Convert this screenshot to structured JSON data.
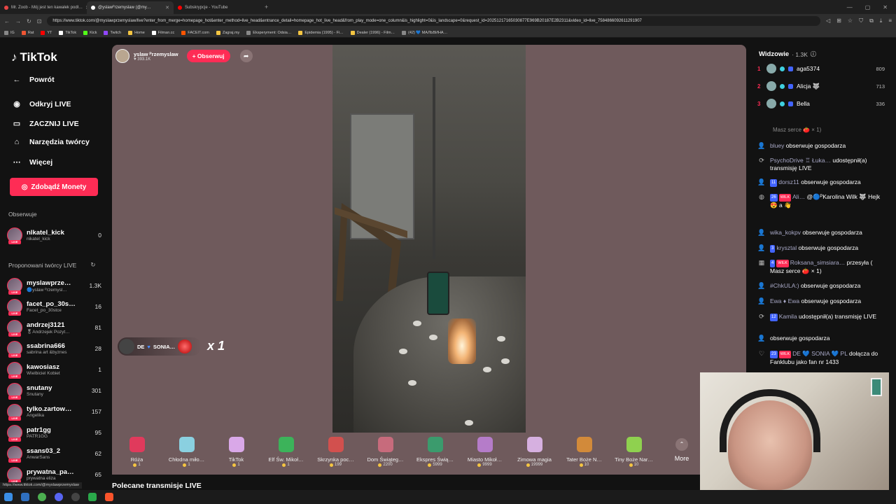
{
  "browser": {
    "tabs": [
      {
        "label": "Mr. Zoob - Mój jest ten kawałek podł…",
        "color": "#e84545",
        "active": false
      },
      {
        "label": "@yslawᴾrzemyslaw (@my…",
        "color": "#ffffff",
        "active": true
      },
      {
        "label": "Subskrypcje - YouTube",
        "color": "#ff0000",
        "active": false
      }
    ],
    "url": "https://www.tiktok.com/@myslawprzemyslaw/live?enter_from_merge=homepage_hot&enter_method=live_head&entrance_detail=homepage_hot_live_head&from_play_mode=one_column&is_highlight=0&is_landscape=0&request_id=20251217165030877E969B20187E2B2311&video_id=live_7584866092611291907",
    "bookmarks": [
      "IG",
      "Rat",
      "YT",
      "TikTok",
      "Kick",
      "Twitch",
      "Home",
      "Filman.cc",
      "FACEIT.com",
      "Zagraj.my",
      "Eksperyment: Odsia…",
      "Epidemia (1995) - Fi…",
      "Dealer (1996) - Film…",
      "(42) 💙 МАЛЬВИНА…"
    ]
  },
  "sidebar": {
    "logo": "TikTok",
    "nav": [
      {
        "label": "Powrót",
        "icon": "←"
      },
      {
        "label": "Odkryj LIVE",
        "icon": "◉"
      },
      {
        "label": "ZACZNIJ LIVE",
        "icon": "▭"
      },
      {
        "label": "Narzędzia twórcy",
        "icon": "⌂"
      },
      {
        "label": "Więcej",
        "icon": "⋯"
      }
    ],
    "coins_button": "Zdobądź Monety",
    "following_header": "Obserwuje",
    "following": [
      {
        "name": "nlkatel_kick",
        "sub": "nikatel_kick",
        "count": "0"
      }
    ],
    "suggested_header": "Proponowani twórcy LIVE",
    "suggested": [
      {
        "name": "myslawprze…",
        "sub": "🔵yslaw ᴾrzemysl…",
        "count": "1.3K"
      },
      {
        "name": "facet_po_30s…",
        "sub": "Facet_po_30stce",
        "count": "16"
      },
      {
        "name": "andrzej3121",
        "sub": "🎖Andrzejek Pozyt…",
        "count": "81"
      },
      {
        "name": "ssabrina666",
        "sub": "sabrina art &byznes",
        "count": "28"
      },
      {
        "name": "kawosiasz",
        "sub": "Wielbiciel Kobiet",
        "count": "1"
      },
      {
        "name": "snutany",
        "sub": "Snutany",
        "count": "301"
      },
      {
        "name": "tylko.zartow…",
        "sub": "Angelika",
        "count": "157"
      },
      {
        "name": "patr1gg",
        "sub": "PATR1GG",
        "count": "95"
      },
      {
        "name": "ssans03_2",
        "sub": "AnwarSans",
        "count": "62"
      },
      {
        "name": "prywatna_pa…",
        "sub": "prywatna eliza",
        "count": "65"
      }
    ],
    "status_url": "https://www.tiktok.com/@myslawprzemyslaw"
  },
  "stream": {
    "host_name": "yslaw ᴾrzemyslaw",
    "host_likes": "393.1K",
    "follow_label": "+ Obserwuj",
    "gift_popup": {
      "name": "SONIA…",
      "prefix": "DE",
      "multiplier": "x 1"
    }
  },
  "gifts": [
    {
      "label": "Róża",
      "price": "1",
      "color": "#e03a5c"
    },
    {
      "label": "Chłodna miło…",
      "price": "1",
      "color": "#8ad0e0"
    },
    {
      "label": "TikTok",
      "price": "1",
      "color": "#d9a8e8"
    },
    {
      "label": "Elf Św. Mikoł…",
      "price": "1",
      "color": "#3cb35a"
    },
    {
      "label": "Skrzynka poc…",
      "price": "199",
      "color": "#d2504e"
    },
    {
      "label": "Dom Świąteg…",
      "price": "2200",
      "color": "#c76b7c"
    },
    {
      "label": "Ekspres Świą…",
      "price": "5999",
      "color": "#3b9b6d"
    },
    {
      "label": "Miasto Mikoł…",
      "price": "9999",
      "color": "#b57cc9"
    },
    {
      "label": "Zimowa magia",
      "price": "19999",
      "color": "#d6b0e0"
    },
    {
      "label": "Tater Boże N…",
      "price": "10",
      "color": "#d28a3a"
    },
    {
      "label": "Tiny Boże Nar…",
      "price": "10",
      "color": "#8fd14f"
    }
  ],
  "more_label": "More",
  "recommended_label": "Polecane transmisje LIVE",
  "viewers": {
    "header": "Widzowie",
    "count": "· 1.3K",
    "list": [
      {
        "rank": "1",
        "name": "aga5374",
        "score": "809"
      },
      {
        "rank": "2",
        "name": "Alicja 🐺",
        "score": "713"
      },
      {
        "rank": "3",
        "name": "Bella",
        "score": "336"
      }
    ]
  },
  "chat": {
    "faded": "Masz serce 🍅 × 1)",
    "messages": [
      {
        "icon": "👤",
        "user": "bluey",
        "text": "obserwuje gospodarza"
      },
      {
        "icon": "⟳",
        "user": "PsychoDrive ♖ Łuka…",
        "text": "udostępnił(a) transmisję LIVE"
      },
      {
        "icon": "👤",
        "user": "dorsz11",
        "text": "obserwuje gospodarza",
        "lvl": "11"
      },
      {
        "icon": "◍",
        "user": "Ali…",
        "text": "@🔵ᴾKarolina Wilk 🐺 Hejk 😍 a 👋",
        "lvl": "26",
        "wilk": "WILK"
      },
      {
        "icon": "👤",
        "user": "wika_kokpv",
        "text": "obserwuje gospodarza"
      },
      {
        "icon": "👤",
        "user": "krysztal",
        "text": "obserwuje gospodarza",
        "lvl": "3"
      },
      {
        "icon": "▦",
        "user": "Roksana_simsiara…",
        "text": "przesyła ( Masz serce 🍅 × 1)",
        "lvl": "4",
        "wilk": "WILK"
      },
      {
        "icon": "👤",
        "user": "#ChkULA:)",
        "text": "obserwuje gospodarza"
      },
      {
        "icon": "👤",
        "user": "Ewa ♦ Ewa",
        "text": "obserwuje gospodarza"
      },
      {
        "icon": "⟳",
        "user": "Kamila",
        "text": "udostępnił(a) transmisję LIVE",
        "lvl": "12"
      },
      {
        "icon": "👤",
        "user": "",
        "text": "obserwuje gospodarza"
      },
      {
        "icon": "♡",
        "user": "DE 💙 SONIA 💙 PL",
        "text": "dołącza do Fanklubu jako fan nr 1433",
        "lvl": "23",
        "wilk": "WILK"
      }
    ]
  }
}
